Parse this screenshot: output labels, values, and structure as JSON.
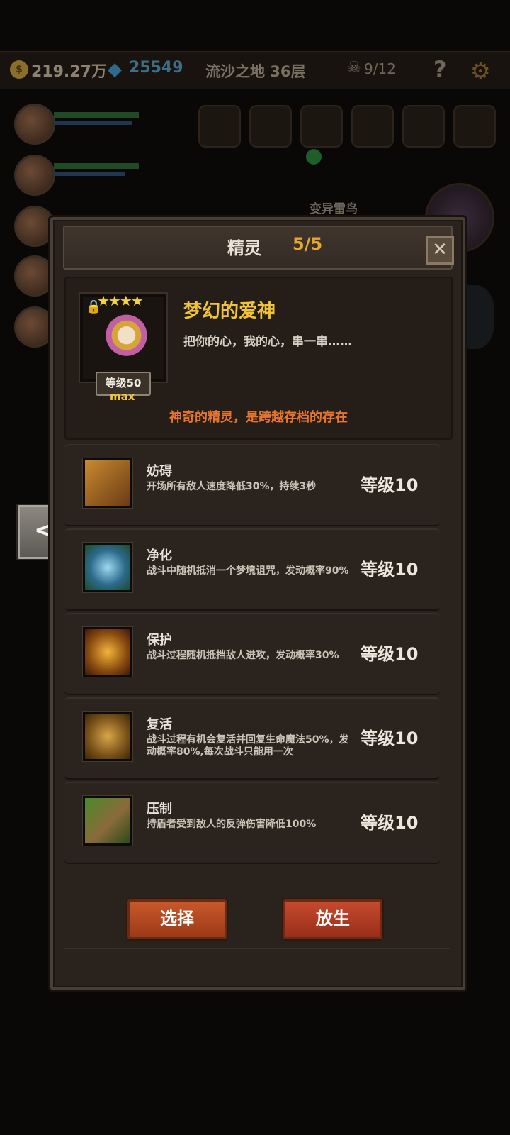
{
  "topbar": {
    "gold": "219.27万",
    "coin_symbol": "$",
    "gem_symbol": "◆",
    "gems": "25549",
    "stage": "流沙之地 36层",
    "skull_symbol": "☠",
    "kills": "9/12",
    "help_symbol": "?",
    "gear_symbol": "⚙"
  },
  "battlefield": {
    "enemy_name": "变异雷鸟"
  },
  "dialog": {
    "title": "精灵",
    "count": "5/5",
    "close_symbol": "✕",
    "spirit": {
      "stars": "★★★★",
      "lock_symbol": "🔒",
      "level": "等级50",
      "level_max": "max",
      "name": "梦幻的爱神",
      "description": "把你的心，我的心，串一串……",
      "note": "神奇的精灵，是跨越存档的存在"
    },
    "skills": [
      {
        "name": "妨碍",
        "desc": "开场所有敌人速度降低30%，持续3秒",
        "level": "等级10",
        "icon": "chained-boot-icon"
      },
      {
        "name": "净化",
        "desc": "战斗中随机抵消一个梦境诅咒，发动概率90%",
        "level": "等级10",
        "icon": "blue-flower-icon"
      },
      {
        "name": "保护",
        "desc": "战斗过程随机抵挡敌人进攻，发动概率30%",
        "level": "等级10",
        "icon": "guardian-figure-icon"
      },
      {
        "name": "复活",
        "desc": "战斗过程有机会复活并回复生命魔法50%，发动概率80%,每次战斗只能用一次",
        "level": "等级10",
        "icon": "revive-figure-icon"
      },
      {
        "name": "压制",
        "desc": "持盾者受到敌人的反弹伤害降低100%",
        "level": "等级10",
        "icon": "beast-claw-icon"
      }
    ],
    "choose_label": "选择",
    "release_label": "放生"
  },
  "nav": {
    "prev_symbol": "<"
  },
  "colors": {
    "accent_gold": "#f0c436",
    "note_orange": "#e7762c",
    "button_red": "#c9582a"
  }
}
